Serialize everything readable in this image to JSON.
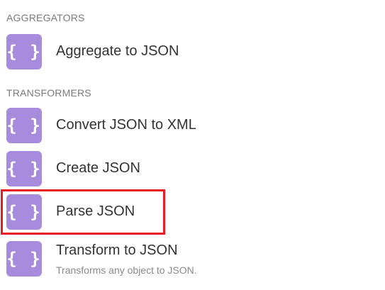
{
  "sections": [
    {
      "header": "AGGREGATORS",
      "modules": [
        {
          "label": "Aggregate to JSON",
          "icon": "json-braces-icon",
          "icon_glyph": "{ }"
        }
      ]
    },
    {
      "header": "TRANSFORMERS",
      "modules": [
        {
          "label": "Convert JSON to XML",
          "icon": "json-braces-icon",
          "icon_glyph": "{ }"
        },
        {
          "label": "Create JSON",
          "icon": "json-braces-icon",
          "icon_glyph": "{ }"
        },
        {
          "label": "Parse JSON",
          "icon": "json-braces-icon",
          "icon_glyph": "{ }",
          "highlighted": true
        },
        {
          "label": "Transform to JSON",
          "description": "Transforms any object to JSON.",
          "icon": "json-braces-icon",
          "icon_glyph": "{ }"
        }
      ]
    }
  ],
  "colors": {
    "icon_bg": "#a78bdc",
    "highlight": "#e81b23"
  }
}
